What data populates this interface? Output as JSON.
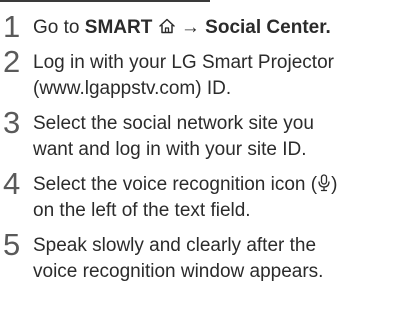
{
  "steps": [
    {
      "number": "1",
      "prefix": "Go to",
      "bold_a": "SMART",
      "arrow": "→",
      "bold_b": "Social Center."
    },
    {
      "number": "2",
      "line1": "Log in with your LG Smart Projector",
      "line2": "(www.lgappstv.com) ID."
    },
    {
      "number": "3",
      "line1": "Select the social network site you",
      "line2": "want and log in with your site ID."
    },
    {
      "number": "4",
      "line1_a": "Select the voice recognition icon (",
      "line1_b": ")",
      "line2": "on the left of the text field."
    },
    {
      "number": "5",
      "line1": "Speak slowly and clearly after the",
      "line2": "voice recognition window appears."
    }
  ],
  "icons": {
    "home": "home-icon",
    "microphone": "microphone-icon"
  },
  "colors": {
    "text": "#2b2b2b",
    "step_number": "#5a5a5a",
    "rule": "#3a3a3a"
  }
}
